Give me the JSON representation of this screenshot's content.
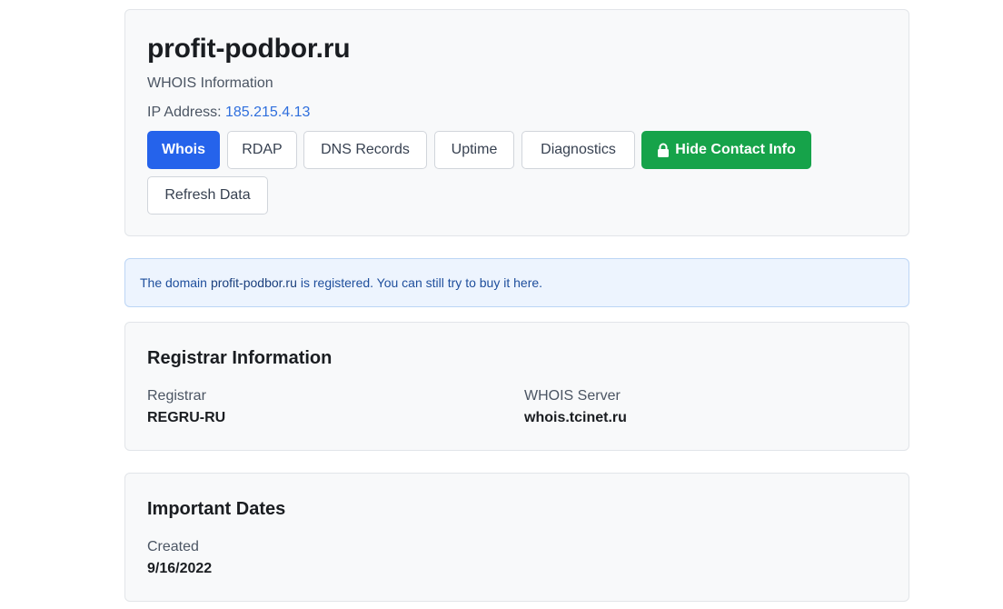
{
  "header": {
    "domain": "profit-podbor.ru",
    "subtitle": "WHOIS Information",
    "ip_label": "IP Address:",
    "ip_value": "185.215.4.13"
  },
  "tabs": {
    "whois": "Whois",
    "rdap": "RDAP",
    "dns": "DNS Records",
    "uptime": "Uptime",
    "diagnostics": "Diagnostics",
    "hide_contact": "Hide Contact Info",
    "refresh": "Refresh Data"
  },
  "alert": {
    "prefix": "The domain",
    "domain": "profit-podbor.ru",
    "middle": "is registered. You can still try to buy it",
    "link": "here",
    "suffix": "."
  },
  "registrar": {
    "title": "Registrar Information",
    "registrar_label": "Registrar",
    "registrar_value": "REGRU-RU",
    "whois_server_label": "WHOIS Server",
    "whois_server_value": "whois.tcinet.ru"
  },
  "dates": {
    "title": "Important Dates",
    "created_label": "Created",
    "created_value": "9/16/2022"
  },
  "colors": {
    "primary": "#2563eb",
    "success": "#16a34a",
    "link": "#2f6fdd",
    "alert_bg": "#edf4fe"
  }
}
